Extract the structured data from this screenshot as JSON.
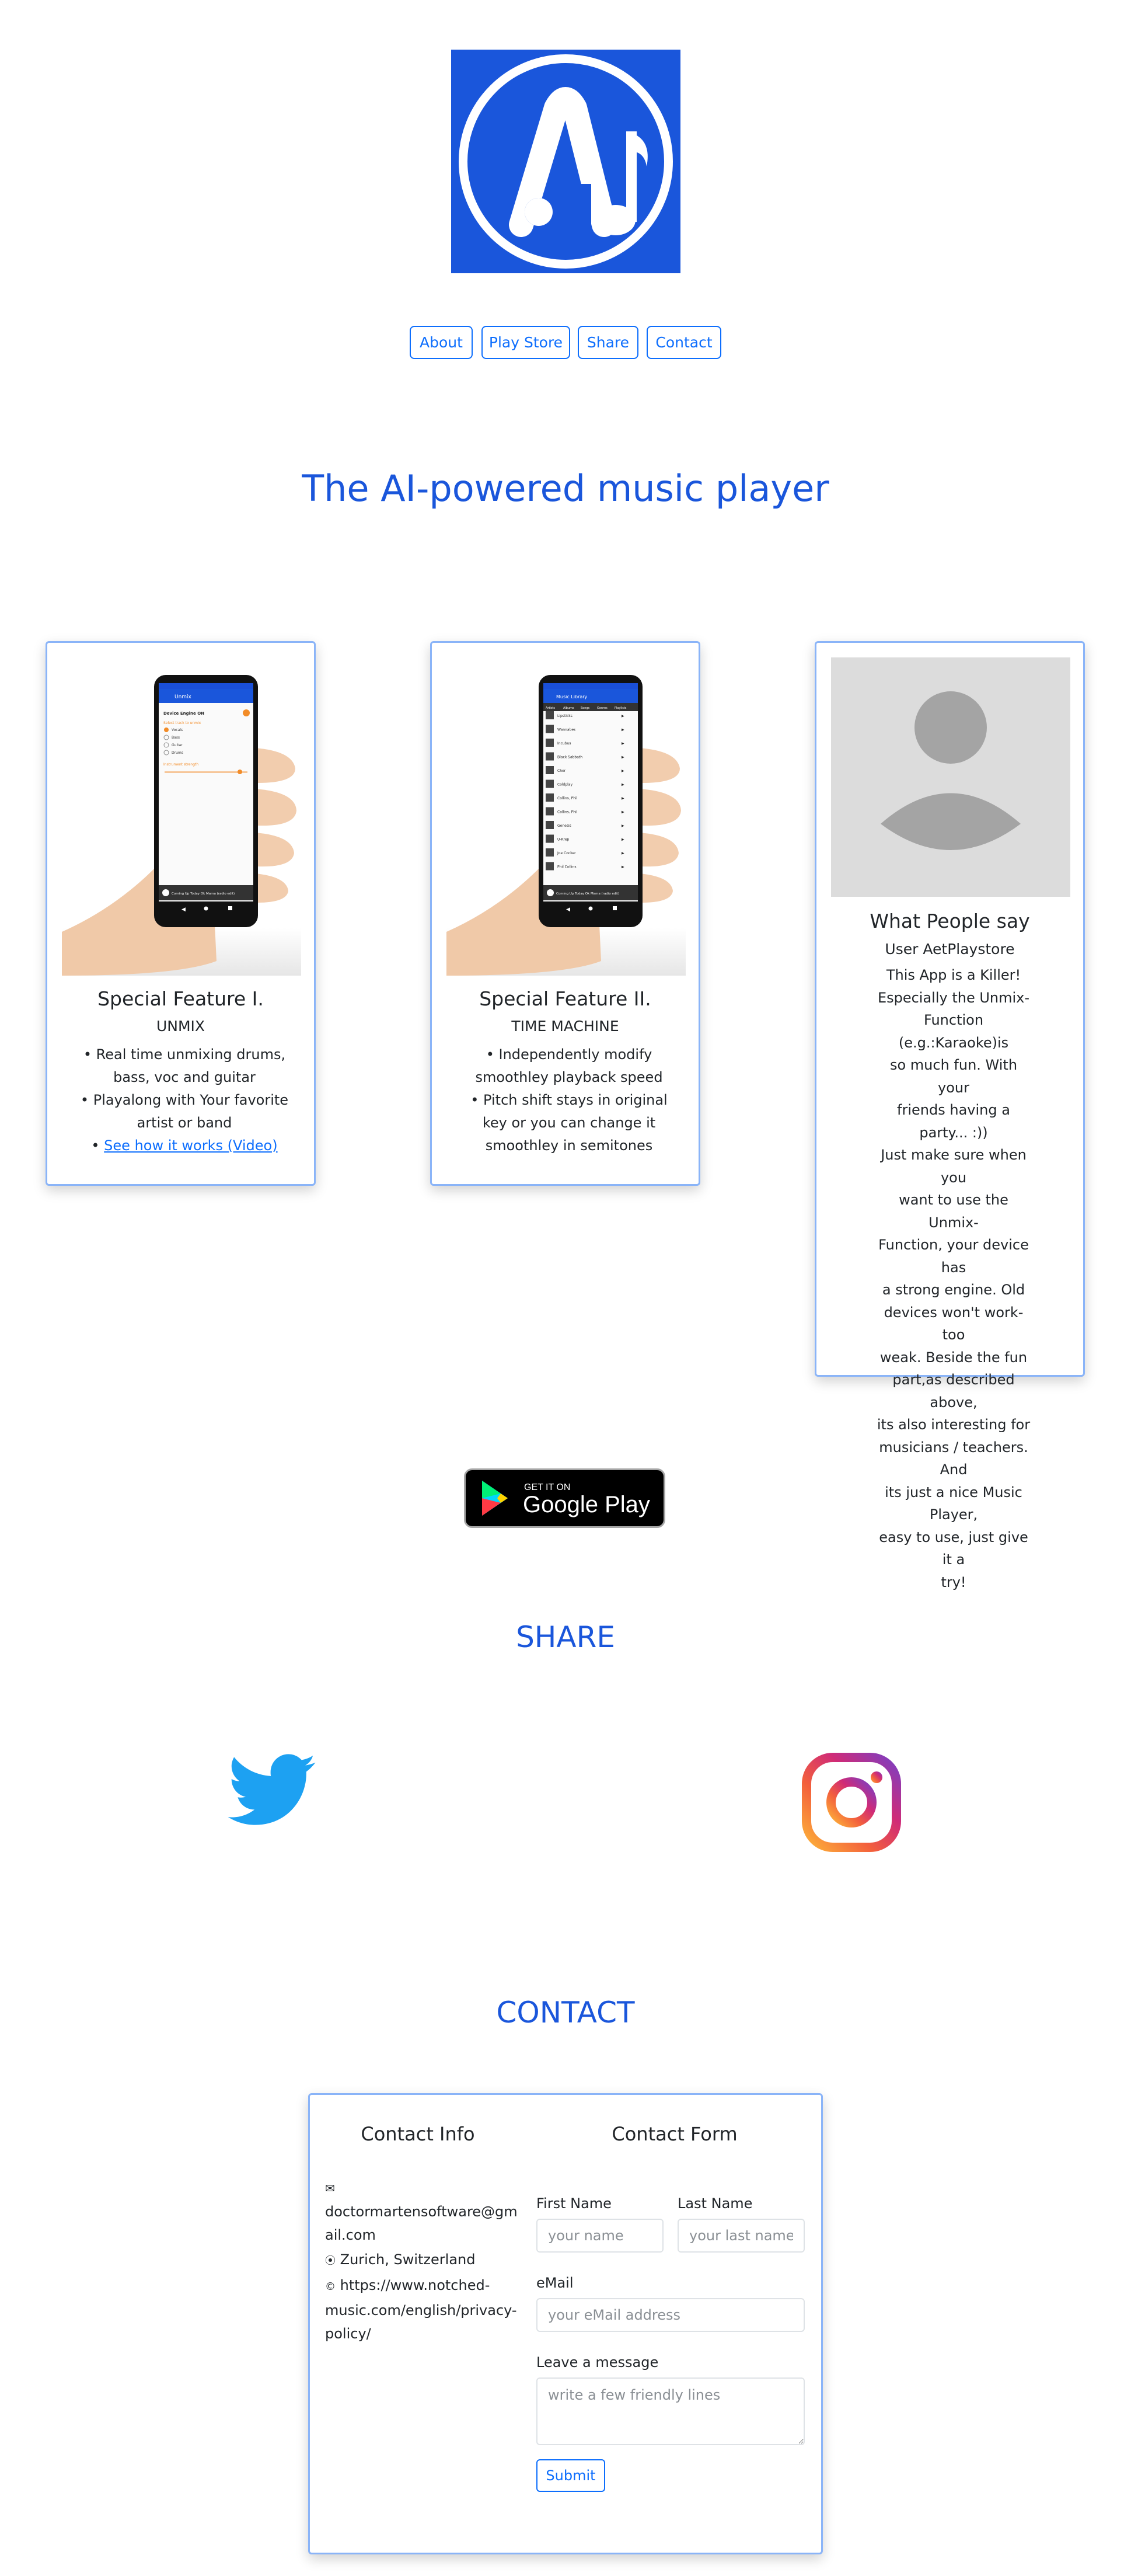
{
  "nav": {
    "about": "About",
    "play_store": "Play Store",
    "share": "Share",
    "contact": "Contact"
  },
  "headline": "The AI-powered music player",
  "features": [
    {
      "title": "Special Feature I.",
      "subtitle": "UNMIX",
      "bullets": [
        "Real time unmixing drums, bass, voc and guitar",
        "Playalong with Your favorite artist or band"
      ],
      "link": "See how it works (Video)",
      "phone": {
        "header": "Unmix",
        "engine_label": "Device Engine ON",
        "options_label": "Select track to unmix",
        "options": [
          "Vocals",
          "Bass",
          "Guitar",
          "Drums"
        ],
        "slider_label": "Instrument strength",
        "player_text": "Coming Up Today Ok Mama (radio edit)"
      }
    },
    {
      "title": "Special Feature II.",
      "subtitle": "TIME MACHINE",
      "bullets": [
        "Independently modify smoothley playback speed",
        "Pitch shift stays in original key or you can change it smoothley in semitones"
      ],
      "phone": {
        "header": "Music Library",
        "tabs": [
          "Artists",
          "Albums",
          "Songs",
          "Genres",
          "Playlists"
        ],
        "rows": [
          "Lipsticks",
          "Wannabes",
          "Incubus",
          "Black Sabbath",
          "Cher",
          "Coldplay",
          "Collins, Phil",
          "Collins, Phil",
          "Genesis",
          "U-Krep",
          "Joe Cocker",
          "Phil Collins"
        ],
        "player_text": "Coming Up Today Ok Mama (radio edit)"
      }
    }
  ],
  "review": {
    "title": "What People say",
    "user": "User AetPlaystore",
    "text_lines": [
      "This App is a Killer!",
      "Especially the Unmix-",
      "Function (e.g.:Karaoke)is",
      "so much fun. With your",
      "friends having a party... :))",
      "Just make sure when you",
      "want to use the Unmix-",
      "Function, your device has",
      "a strong engine. Old",
      "devices won't work- too",
      "weak. Beside the fun",
      "part,as described above,",
      "its also interesting for",
      "musicians / teachers. And",
      "its just a nice Music Player,",
      "easy to use, just give it a",
      "try!"
    ]
  },
  "play_badge": {
    "small": "GET IT ON",
    "big": "Google Play"
  },
  "share": {
    "heading": "SHARE"
  },
  "contact": {
    "heading": "CONTACT",
    "info_title": "Contact Info",
    "form_title": "Contact Form",
    "email_lines": [
      "doctormartensoftware@gm",
      "ail.com"
    ],
    "location": "Zurich, Switzerland",
    "policy_lines": [
      "https://www.notched-",
      "music.com/english/privacy-",
      "policy/"
    ],
    "first_name_label": "First Name",
    "last_name_label": "Last Name",
    "first_name_placeholder": "your name",
    "last_name_placeholder": "your last name",
    "email_label": "eMail",
    "email_placeholder": "your eMail address",
    "message_label": "Leave a message",
    "message_placeholder": "write a few friendly lines",
    "submit": "Submit"
  },
  "colors": {
    "brand_blue": "#1a56db",
    "link_blue": "#0d6efd",
    "card_border": "#8ab4f8"
  }
}
